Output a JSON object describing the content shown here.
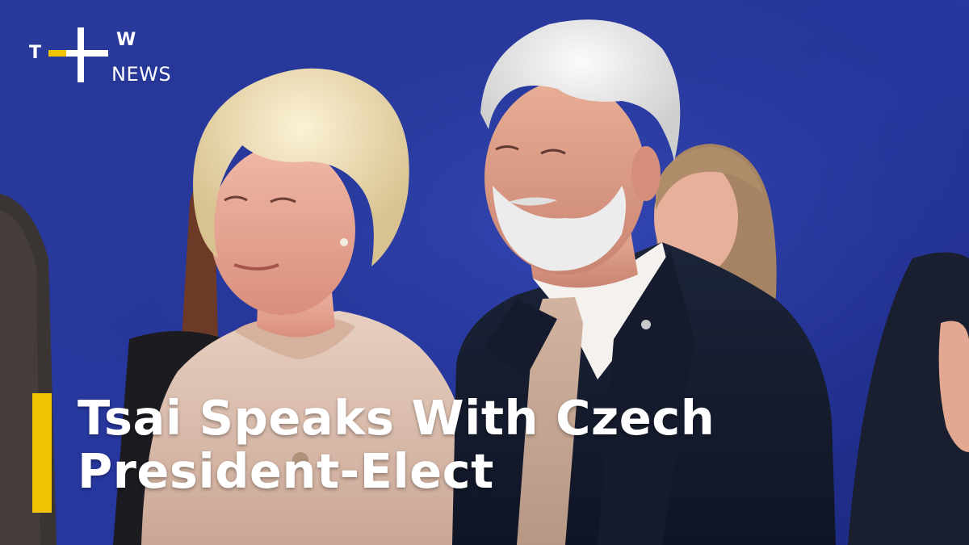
{
  "brand": {
    "letter_t": "T",
    "letter_w": "W",
    "label": "NEWS",
    "accent_color": "#f0c400",
    "text_color": "#ffffff"
  },
  "headline": {
    "line1": "Tsai Speaks With Czech",
    "line2": "President-Elect",
    "bar_color": "#f0c400",
    "text_color": "#ffffff"
  },
  "scene": {
    "background_color": "#1f2f8f",
    "subjects": [
      "woman-left-blond-short-hair",
      "man-center-white-hair-beard",
      "woman-background-right"
    ]
  }
}
